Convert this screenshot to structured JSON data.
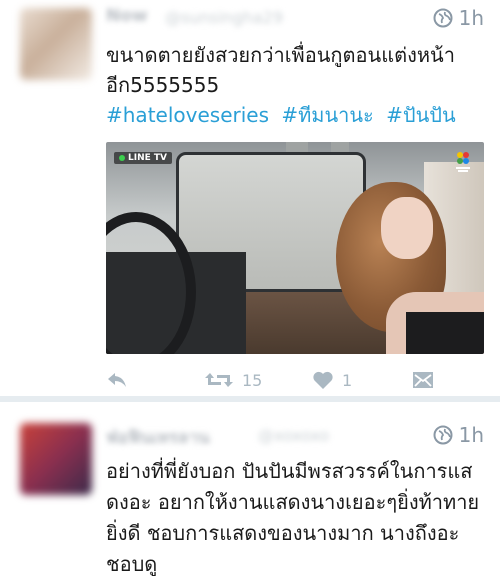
{
  "tweets": [
    {
      "author_name": "Now",
      "author_handle": "@sunsingha29",
      "time": "1h",
      "text": "ขนาดตายยังสวยกว่าเพื่อนกูตอนแต่งหน้าอีก5555555",
      "hashtags": [
        "#hateloveseries",
        "#ทีมนานะ",
        "#ปันปัน"
      ],
      "media": {
        "watermark": "LINE TV"
      },
      "actions": {
        "retweet_count": "15",
        "like_count": "1"
      }
    },
    {
      "author_name": "ฟ่อฟินเทรลาน",
      "author_handle": "@xoxoxo",
      "time": "1h",
      "text": "อย่างที่พี่ยังบอก ปันปันมีพรสวรรค์ในการแสดงอะ อยากให้งานแสดงนางเยอะๆยิ่งท้าทายยิ่งดี ชอบการแสดงของนางมาก นางถึงอะ ชอบดู"
    }
  ],
  "colors": {
    "link": "#2a9fd6",
    "icon": "#aab8c2",
    "meta": "#8a98a5",
    "divider": "#e6ecf0"
  },
  "icons": {
    "globe": "globe-icon",
    "reply": "reply-icon",
    "retweet": "retweet-icon",
    "like": "heart-icon",
    "dm": "direct-message-icon"
  }
}
